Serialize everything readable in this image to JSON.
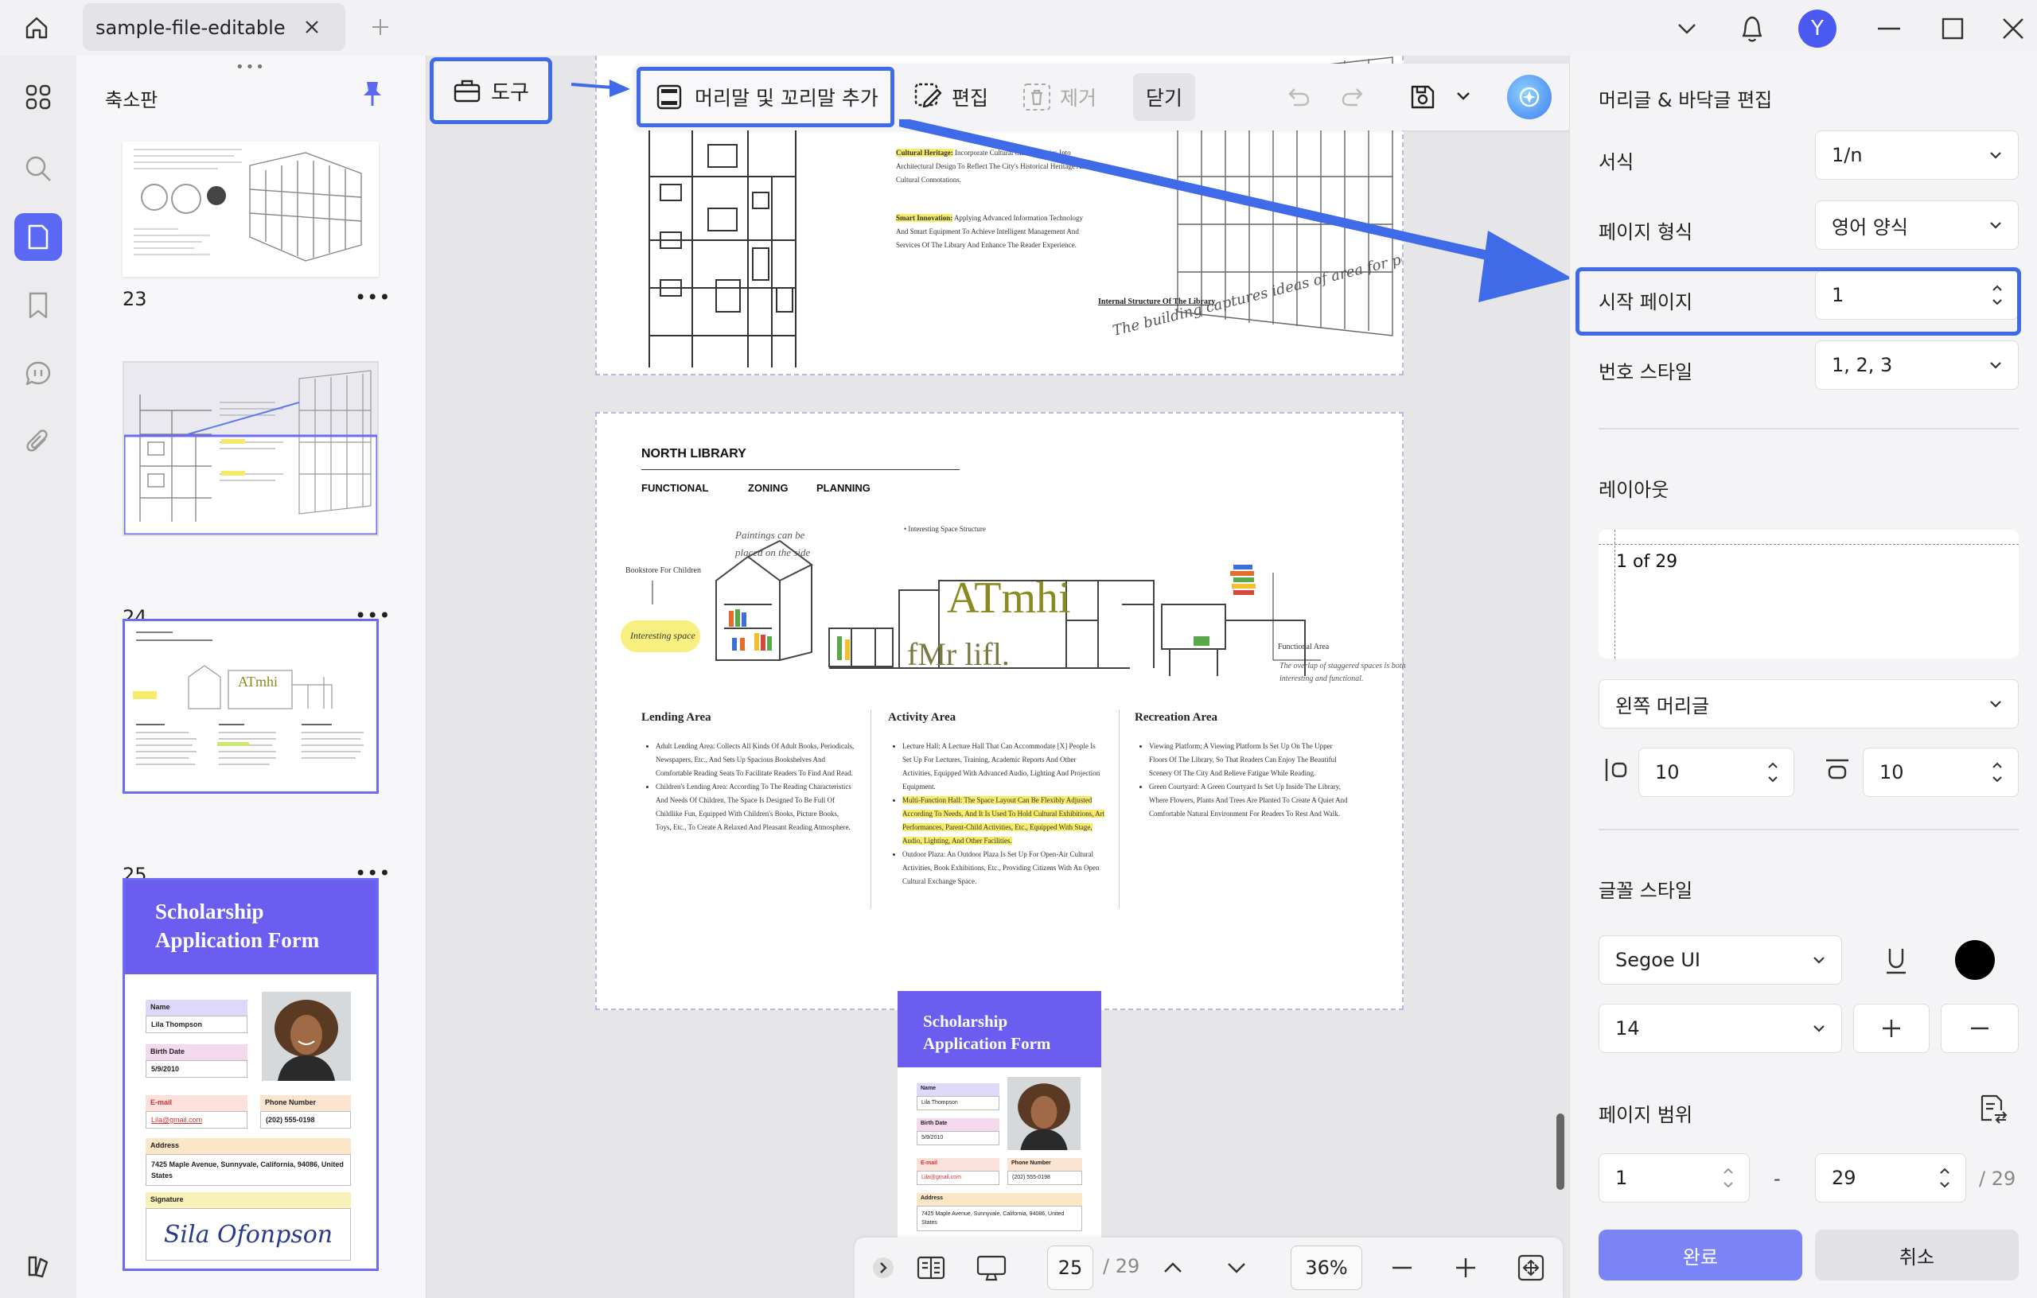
{
  "titlebar": {
    "tab_title": "sample-file-editable",
    "avatar_letter": "Y"
  },
  "thumbnails": {
    "panel_title": "축소판",
    "drag_handle": "•••",
    "pages": [
      {
        "number": "23",
        "more": "•••"
      },
      {
        "number": "24",
        "more": "•••"
      },
      {
        "number": "25",
        "more": "•••"
      }
    ],
    "form_thumb": {
      "title_line1": "Scholarship",
      "title_line2": "Application Form",
      "name_label": "Name",
      "name_value": "Lila Thompson",
      "birth_label": "Birth Date",
      "birth_value": "5/9/2010",
      "email_label": "E-mail",
      "email_value": "Lila@gmail.com",
      "phone_label": "Phone Number",
      "phone_value": "(202) 555-0198",
      "address_label": "Address",
      "address_value": "7425 Maple Avenue, Sunnyvale, California, 94086, United States",
      "signature_label": "Signature",
      "signature_value": "Sila Ofonpson"
    }
  },
  "toolbar": {
    "tools_label": "도구",
    "add_header_footer_label": "머리말 및 꼬리말 추가",
    "edit_label": "편집",
    "remove_label": "제거",
    "close_label": "닫기"
  },
  "document": {
    "page_top": {
      "item1_title": "Cultural Heritage:",
      "item1_text": "Incorporate Cultural Characteristics Into Architectural Design To Reflect The City's Historical Heritage And Cultural Connotations.",
      "item2_title": "Smart Innovation:",
      "item2_text": "Applying Advanced Information Technology And Smart Equipment To Achieve Intelligent Management And Services Of The Library And Enhance The Reader Experience.",
      "caption": "Internal Structure Of The Library",
      "sketch_note": "The building captures ideas of area for peoders"
    },
    "page_main": {
      "title": "NORTH LIBRARY",
      "sub1": "FUNCTIONAL",
      "sub2": "ZONING",
      "sub3": "PLANNING",
      "note_paintings": "Paintings can be placed on the side",
      "note_interesting_structure": "• Interesting Space Structure",
      "note_bookstore": "Bookstore For Children",
      "note_interesting_space": "Interesting space",
      "watermark_big": "ATmhi",
      "watermark_small": "fMr lifl.",
      "note_functional": "Functional Area",
      "note_overlap": "The overlap of staggered spaces is both interesting and functional.",
      "col1_title": "Lending Area",
      "col1_bullets": [
        "Adult Lending Area: Collects All Kinds Of Adult Books, Periodicals, Newspapers, Etc., And Sets Up Spacious Bookshelves And Comfortable Reading Seats To Facilitate Readers To Find And Read.",
        "Children's Lending Area: According To The Reading Characteristics And Needs Of Children, The Space Is Designed To Be Full Of Childlike Fun, Equipped With Children's Books, Picture Books, Toys, Etc., To Create A Relaxed And Pleasant Reading Atmosphere."
      ],
      "col2_title": "Activity Area",
      "col2_bullets": [
        "Lecture Hall: A Lecture Hall That Can Accommodate [X] People Is Set Up For Lectures, Training, Academic Reports And Other Activities, Equipped With Advanced Audio, Lighting And Projection Equipment.",
        "Multi-Function Hall: The Space Layout Can Be Flexibly Adjusted According To Needs, And It Is Used To Hold Cultural Exhibitions, Art Performances, Parent-Child Activities, Etc., Equipped With Stage, Audio, Lighting, And Other Facilities.",
        "Outdoor Plaza: An Outdoor Plaza Is Set Up For Open-Air Cultural Activities, Book Exhibitions, Etc., Providing Citizens With An Open Cultural Exchange Space."
      ],
      "col3_title": "Recreation Area",
      "col3_bullets": [
        "Viewing Platform: A Viewing Platform Is Set Up On The Upper Floors Of The Library, So That Readers Can Enjoy The Beautiful Scenery Of The City And Relieve Fatigue While Reading.",
        "Green Courtyard: A Green Courtyard Is Set Up Inside The Library, Where Flowers, Plants And Trees Are Planted To Create A Quiet And Comfortable Natural Environment For Readers To Rest And Walk."
      ]
    }
  },
  "bottombar": {
    "current_page": "25",
    "total_pages": "/ 29",
    "zoom": "36%"
  },
  "panel": {
    "title": "머리글 & 바닥글 편집",
    "format_label": "서식",
    "format_value": "1/n",
    "page_format_label": "페이지 형식",
    "page_format_value": "영어 양식",
    "start_page_label": "시작 페이지",
    "start_page_value": "1",
    "number_style_label": "번호 스타일",
    "number_style_value": "1, 2, 3",
    "layout_label": "레이아웃",
    "layout_preview": "1 of 29",
    "position_value": "왼쪽 머리글",
    "margin_left_value": "10",
    "margin_top_value": "10",
    "font_style_label": "글꼴 스타일",
    "font_family_value": "Segoe UI",
    "font_size_value": "14",
    "font_color": "#000000",
    "page_range_label": "페이지 범위",
    "range_from": "1",
    "range_dash": "-",
    "range_to": "29",
    "range_total": "/ 29",
    "done_label": "완료",
    "cancel_label": "취소"
  },
  "colors": {
    "accent": "#5b68f3",
    "highlight_border": "#3f6be8",
    "form_header": "#6b5df0"
  }
}
